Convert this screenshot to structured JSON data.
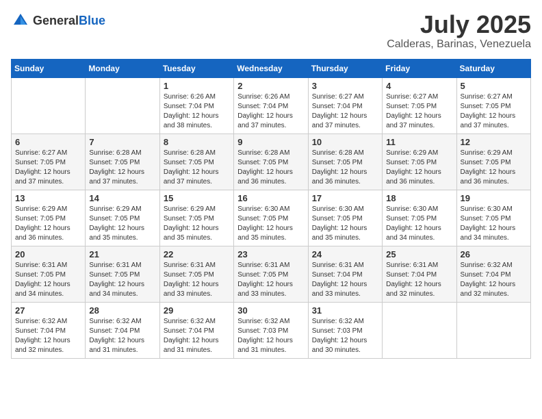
{
  "header": {
    "logo_general": "General",
    "logo_blue": "Blue",
    "month": "July 2025",
    "location": "Calderas, Barinas, Venezuela"
  },
  "days_of_week": [
    "Sunday",
    "Monday",
    "Tuesday",
    "Wednesday",
    "Thursday",
    "Friday",
    "Saturday"
  ],
  "weeks": [
    [
      {
        "day": "",
        "sunrise": "",
        "sunset": "",
        "daylight": ""
      },
      {
        "day": "",
        "sunrise": "",
        "sunset": "",
        "daylight": ""
      },
      {
        "day": "1",
        "sunrise": "Sunrise: 6:26 AM",
        "sunset": "Sunset: 7:04 PM",
        "daylight": "Daylight: 12 hours and 38 minutes."
      },
      {
        "day": "2",
        "sunrise": "Sunrise: 6:26 AM",
        "sunset": "Sunset: 7:04 PM",
        "daylight": "Daylight: 12 hours and 37 minutes."
      },
      {
        "day": "3",
        "sunrise": "Sunrise: 6:27 AM",
        "sunset": "Sunset: 7:04 PM",
        "daylight": "Daylight: 12 hours and 37 minutes."
      },
      {
        "day": "4",
        "sunrise": "Sunrise: 6:27 AM",
        "sunset": "Sunset: 7:05 PM",
        "daylight": "Daylight: 12 hours and 37 minutes."
      },
      {
        "day": "5",
        "sunrise": "Sunrise: 6:27 AM",
        "sunset": "Sunset: 7:05 PM",
        "daylight": "Daylight: 12 hours and 37 minutes."
      }
    ],
    [
      {
        "day": "6",
        "sunrise": "Sunrise: 6:27 AM",
        "sunset": "Sunset: 7:05 PM",
        "daylight": "Daylight: 12 hours and 37 minutes."
      },
      {
        "day": "7",
        "sunrise": "Sunrise: 6:28 AM",
        "sunset": "Sunset: 7:05 PM",
        "daylight": "Daylight: 12 hours and 37 minutes."
      },
      {
        "day": "8",
        "sunrise": "Sunrise: 6:28 AM",
        "sunset": "Sunset: 7:05 PM",
        "daylight": "Daylight: 12 hours and 37 minutes."
      },
      {
        "day": "9",
        "sunrise": "Sunrise: 6:28 AM",
        "sunset": "Sunset: 7:05 PM",
        "daylight": "Daylight: 12 hours and 36 minutes."
      },
      {
        "day": "10",
        "sunrise": "Sunrise: 6:28 AM",
        "sunset": "Sunset: 7:05 PM",
        "daylight": "Daylight: 12 hours and 36 minutes."
      },
      {
        "day": "11",
        "sunrise": "Sunrise: 6:29 AM",
        "sunset": "Sunset: 7:05 PM",
        "daylight": "Daylight: 12 hours and 36 minutes."
      },
      {
        "day": "12",
        "sunrise": "Sunrise: 6:29 AM",
        "sunset": "Sunset: 7:05 PM",
        "daylight": "Daylight: 12 hours and 36 minutes."
      }
    ],
    [
      {
        "day": "13",
        "sunrise": "Sunrise: 6:29 AM",
        "sunset": "Sunset: 7:05 PM",
        "daylight": "Daylight: 12 hours and 36 minutes."
      },
      {
        "day": "14",
        "sunrise": "Sunrise: 6:29 AM",
        "sunset": "Sunset: 7:05 PM",
        "daylight": "Daylight: 12 hours and 35 minutes."
      },
      {
        "day": "15",
        "sunrise": "Sunrise: 6:29 AM",
        "sunset": "Sunset: 7:05 PM",
        "daylight": "Daylight: 12 hours and 35 minutes."
      },
      {
        "day": "16",
        "sunrise": "Sunrise: 6:30 AM",
        "sunset": "Sunset: 7:05 PM",
        "daylight": "Daylight: 12 hours and 35 minutes."
      },
      {
        "day": "17",
        "sunrise": "Sunrise: 6:30 AM",
        "sunset": "Sunset: 7:05 PM",
        "daylight": "Daylight: 12 hours and 35 minutes."
      },
      {
        "day": "18",
        "sunrise": "Sunrise: 6:30 AM",
        "sunset": "Sunset: 7:05 PM",
        "daylight": "Daylight: 12 hours and 34 minutes."
      },
      {
        "day": "19",
        "sunrise": "Sunrise: 6:30 AM",
        "sunset": "Sunset: 7:05 PM",
        "daylight": "Daylight: 12 hours and 34 minutes."
      }
    ],
    [
      {
        "day": "20",
        "sunrise": "Sunrise: 6:31 AM",
        "sunset": "Sunset: 7:05 PM",
        "daylight": "Daylight: 12 hours and 34 minutes."
      },
      {
        "day": "21",
        "sunrise": "Sunrise: 6:31 AM",
        "sunset": "Sunset: 7:05 PM",
        "daylight": "Daylight: 12 hours and 34 minutes."
      },
      {
        "day": "22",
        "sunrise": "Sunrise: 6:31 AM",
        "sunset": "Sunset: 7:05 PM",
        "daylight": "Daylight: 12 hours and 33 minutes."
      },
      {
        "day": "23",
        "sunrise": "Sunrise: 6:31 AM",
        "sunset": "Sunset: 7:05 PM",
        "daylight": "Daylight: 12 hours and 33 minutes."
      },
      {
        "day": "24",
        "sunrise": "Sunrise: 6:31 AM",
        "sunset": "Sunset: 7:04 PM",
        "daylight": "Daylight: 12 hours and 33 minutes."
      },
      {
        "day": "25",
        "sunrise": "Sunrise: 6:31 AM",
        "sunset": "Sunset: 7:04 PM",
        "daylight": "Daylight: 12 hours and 32 minutes."
      },
      {
        "day": "26",
        "sunrise": "Sunrise: 6:32 AM",
        "sunset": "Sunset: 7:04 PM",
        "daylight": "Daylight: 12 hours and 32 minutes."
      }
    ],
    [
      {
        "day": "27",
        "sunrise": "Sunrise: 6:32 AM",
        "sunset": "Sunset: 7:04 PM",
        "daylight": "Daylight: 12 hours and 32 minutes."
      },
      {
        "day": "28",
        "sunrise": "Sunrise: 6:32 AM",
        "sunset": "Sunset: 7:04 PM",
        "daylight": "Daylight: 12 hours and 31 minutes."
      },
      {
        "day": "29",
        "sunrise": "Sunrise: 6:32 AM",
        "sunset": "Sunset: 7:04 PM",
        "daylight": "Daylight: 12 hours and 31 minutes."
      },
      {
        "day": "30",
        "sunrise": "Sunrise: 6:32 AM",
        "sunset": "Sunset: 7:03 PM",
        "daylight": "Daylight: 12 hours and 31 minutes."
      },
      {
        "day": "31",
        "sunrise": "Sunrise: 6:32 AM",
        "sunset": "Sunset: 7:03 PM",
        "daylight": "Daylight: 12 hours and 30 minutes."
      },
      {
        "day": "",
        "sunrise": "",
        "sunset": "",
        "daylight": ""
      },
      {
        "day": "",
        "sunrise": "",
        "sunset": "",
        "daylight": ""
      }
    ]
  ]
}
